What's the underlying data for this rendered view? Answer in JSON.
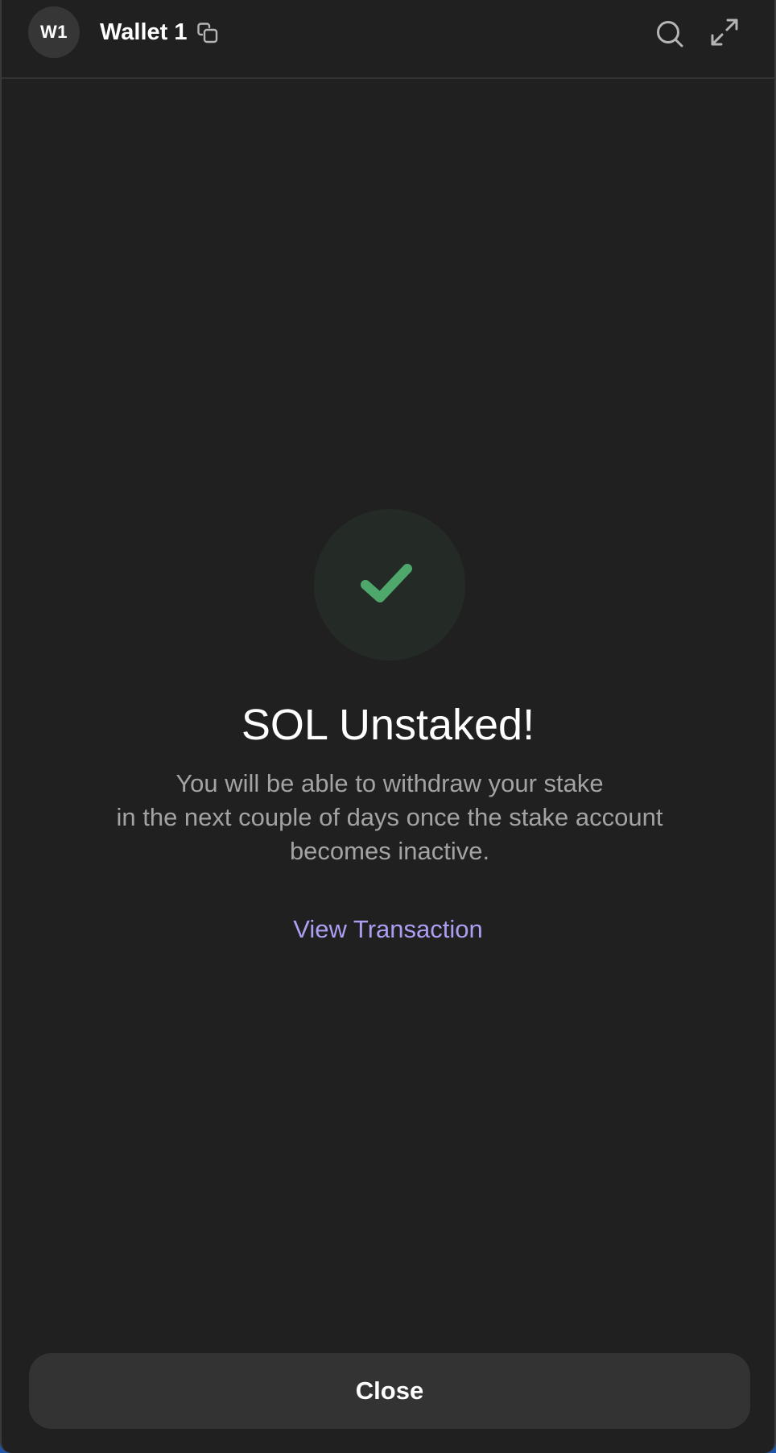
{
  "header": {
    "avatar_initials": "W1",
    "wallet_name": "Wallet 1",
    "icons": [
      "copy-icon",
      "search-icon",
      "expand-icon"
    ]
  },
  "result": {
    "icon": "checkmark-icon",
    "title": "SOL Unstaked!",
    "message_lines": [
      "You will be able to withdraw your stake",
      "in the next couple of days once the stake account",
      "becomes inactive."
    ],
    "view_transaction_label": "View Transaction"
  },
  "footer": {
    "close_label": "Close"
  },
  "colors": {
    "background": "#202020",
    "success_green": "#4fa86b",
    "success_circle": "#242a26",
    "link_purple": "#ab9ff2",
    "muted_text": "#a3a3a3",
    "button_bg": "#333333",
    "desktop_blue": "#1f55a8"
  }
}
